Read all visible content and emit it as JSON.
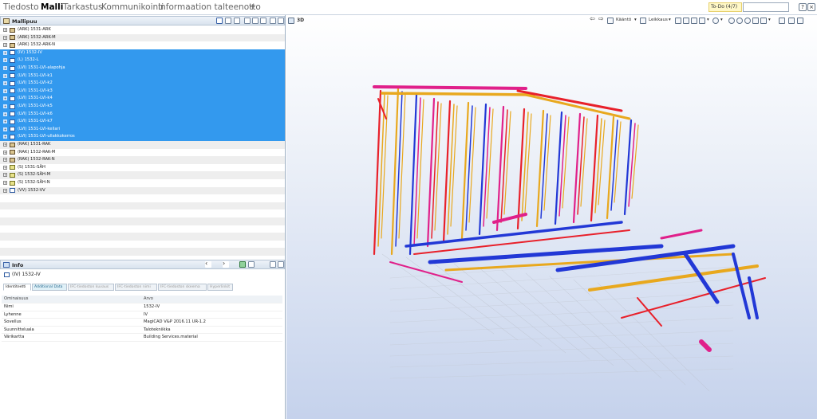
{
  "menu": [
    "Tiedosto",
    "Malli",
    "Tarkastus",
    "Kommunikointi",
    "Informaation talteenotto",
    "+"
  ],
  "active_menu": "Malli",
  "todo_label": "To-Do (4/7)",
  "model_tree": {
    "title": "Mallipuu",
    "items": [
      {
        "label": "(ARK) 1531-ARK",
        "type": "ark",
        "selected": false
      },
      {
        "label": "(ARK) 1532-ARK-M",
        "type": "ark",
        "selected": false
      },
      {
        "label": "(ARK) 1532-ARK-N",
        "type": "ark",
        "selected": false
      },
      {
        "label": "(IV) 1532-IV",
        "type": "lvi",
        "selected": true
      },
      {
        "label": "(L) 1532-L",
        "type": "lvi",
        "selected": true
      },
      {
        "label": "(LVI) 1531-LVI-alapohja",
        "type": "lvi",
        "selected": true
      },
      {
        "label": "(LVI) 1531-LVI-k1",
        "type": "lvi",
        "selected": true
      },
      {
        "label": "(LVI) 1531-LVI-k2",
        "type": "lvi",
        "selected": true
      },
      {
        "label": "(LVI) 1531-LVI-k3",
        "type": "lvi",
        "selected": true
      },
      {
        "label": "(LVI) 1531-LVI-k4",
        "type": "lvi",
        "selected": true
      },
      {
        "label": "(LVI) 1531-LVI-k5",
        "type": "lvi",
        "selected": true
      },
      {
        "label": "(LVI) 1531-LVI-k6",
        "type": "lvi",
        "selected": true
      },
      {
        "label": "(LVI) 1531-LVI-k7",
        "type": "lvi",
        "selected": true
      },
      {
        "label": "(LVI) 1531-LVI-kellari",
        "type": "lvi",
        "selected": true
      },
      {
        "label": "(LVI) 1531-LVI-ullakkokerros",
        "type": "lvi",
        "selected": true
      },
      {
        "label": "(RAK) 1531-RAK",
        "type": "ark",
        "selected": false
      },
      {
        "label": "(RAK) 1532-RAK-M",
        "type": "ark",
        "selected": false
      },
      {
        "label": "(RAK) 1532-RAK-N",
        "type": "ark",
        "selected": false
      },
      {
        "label": "(S) 1531-SÄH",
        "type": "sah",
        "selected": false
      },
      {
        "label": "(S) 1532-SÄH-M",
        "type": "sah",
        "selected": false
      },
      {
        "label": "(S) 1532-SÄH-N",
        "type": "sah",
        "selected": false
      },
      {
        "label": "(VV) 1532-VV",
        "type": "lvi",
        "selected": false
      }
    ]
  },
  "info": {
    "title": "Info",
    "selected_item": "(IV) 1532-IV",
    "tabs": [
      "Identiteetti",
      "Additional Data",
      "IFC-tiedoston kuvaus",
      "IFC-tiedoston nimi",
      "IFC-tiedoston skeema",
      "Hyperlinkit"
    ],
    "active_tab": "Identiteetti",
    "columns": [
      "Ominaisuus",
      "Arvo"
    ],
    "rows": [
      [
        "Nimi",
        "1532-IV"
      ],
      [
        "Lyhenne",
        "IV"
      ],
      [
        "Sovellus",
        "MagiCAD V&P 2016.11 UR-1.2"
      ],
      [
        "Suunnitteluala",
        "Talotekniikka"
      ],
      [
        "Värikartta",
        "Building Services.material"
      ]
    ]
  },
  "viewport": {
    "label": "3D",
    "toolbar": [
      "Kääntö",
      "Leikkaus"
    ],
    "colors": {
      "red": "#e8202a",
      "blue": "#2238d6",
      "yellow": "#e8a81e",
      "magenta": "#e0208a",
      "white": "#ffffff"
    }
  }
}
